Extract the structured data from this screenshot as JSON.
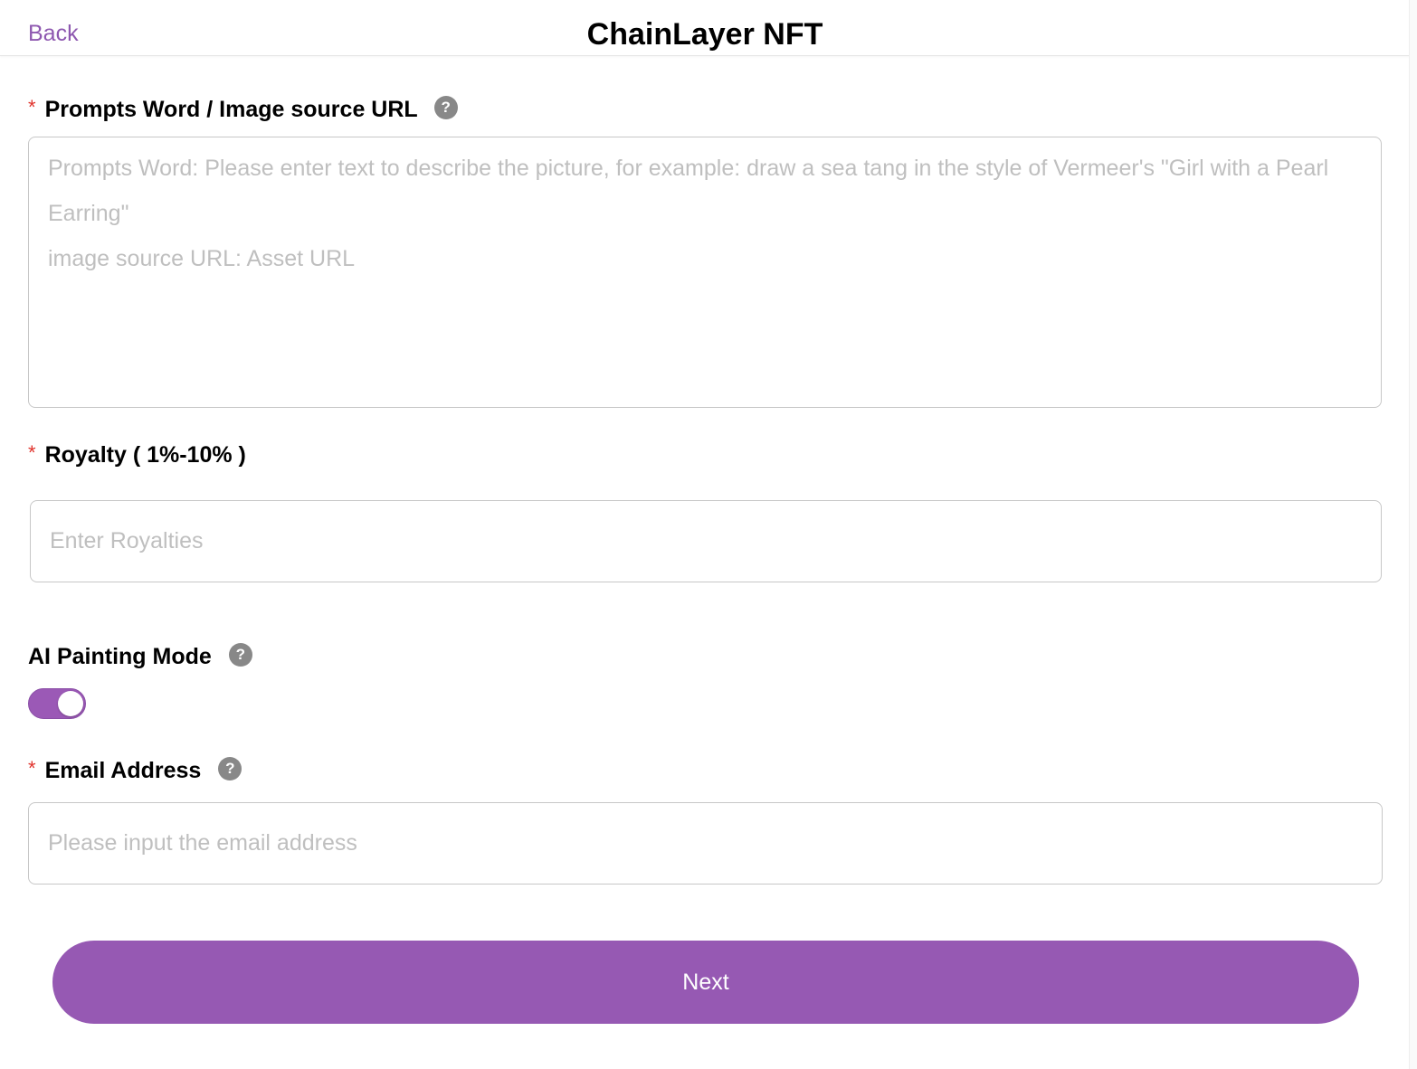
{
  "header": {
    "back_label": "Back",
    "title": "ChainLayer NFT"
  },
  "form": {
    "prompt": {
      "required_mark": "*",
      "label": "Prompts Word / Image source URL",
      "help_glyph": "?",
      "placeholder_line1": "Prompts Word: Please enter text to describe the picture, for example: draw a sea tang in the style of Vermeer's \"Girl with a Pearl Earring\"",
      "placeholder_line2": "image source URL: Asset URL",
      "value": ""
    },
    "royalty": {
      "required_mark": "*",
      "label": "Royalty ( 1%-10% )",
      "placeholder": "Enter Royalties",
      "value": ""
    },
    "ai_painting_mode": {
      "label": "AI Painting Mode",
      "help_glyph": "?",
      "enabled": true
    },
    "email": {
      "required_mark": "*",
      "label": "Email Address",
      "help_glyph": "?",
      "placeholder": "Please input the email address",
      "value": ""
    }
  },
  "actions": {
    "next_label": "Next"
  },
  "icons": {
    "help": "question-circle-icon"
  },
  "colors": {
    "accent": "#9659b3",
    "back_link": "#8e58b0",
    "required": "#e0322b",
    "placeholder": "#bfbfbf",
    "help_icon_bg": "#888888"
  }
}
